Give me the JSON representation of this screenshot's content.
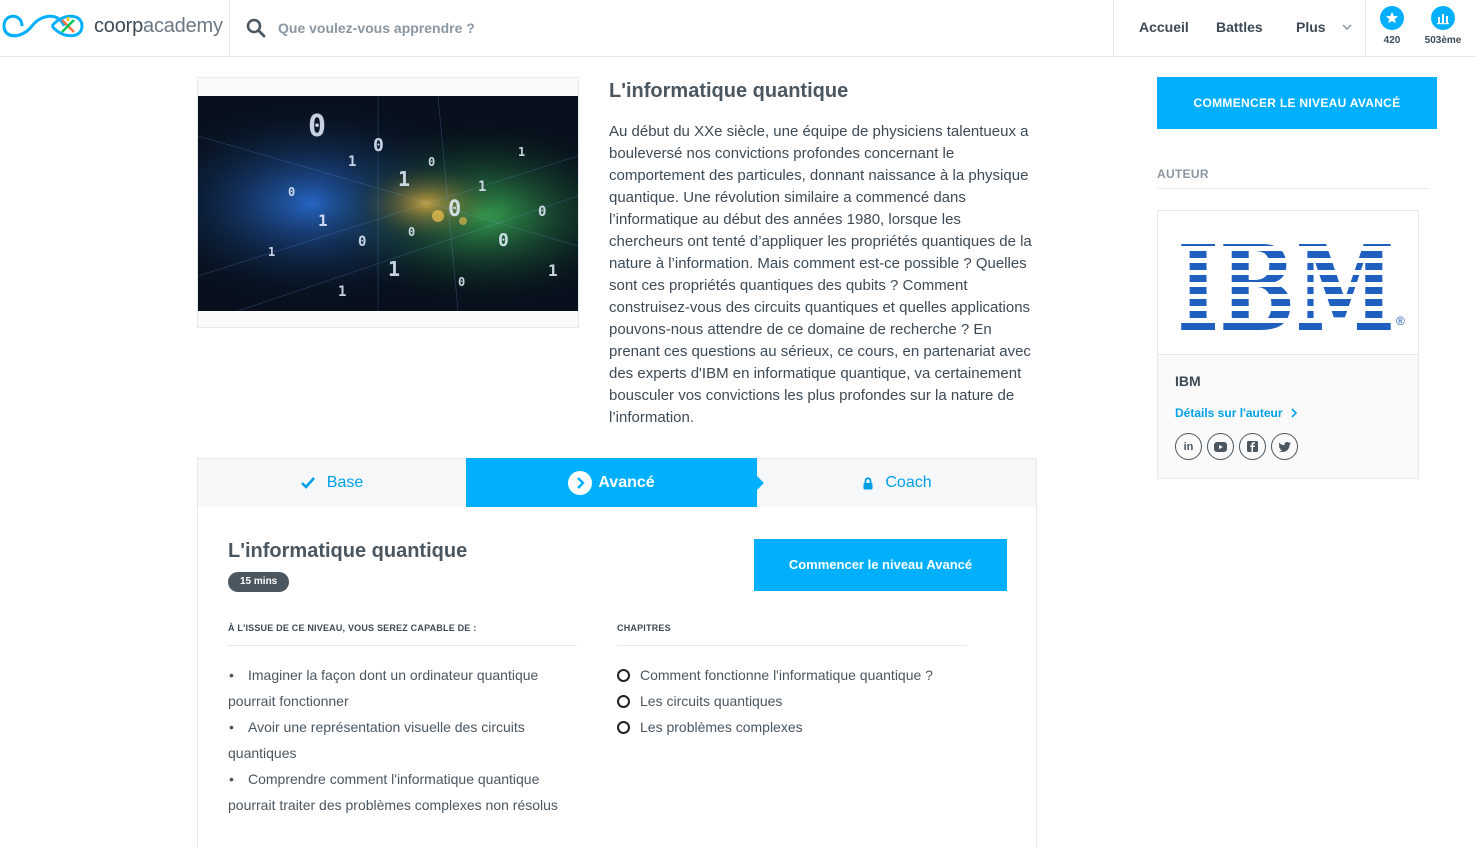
{
  "header": {
    "logo": {
      "brand_bold": "coorp",
      "brand_light": "academy"
    },
    "search": {
      "placeholder": "Que voulez-vous apprendre ?",
      "icon": "search-icon"
    },
    "nav": {
      "home": "Accueil",
      "battles": "Battles",
      "more": "Plus"
    },
    "stats": {
      "stars": "420",
      "rank": "503ème"
    }
  },
  "course": {
    "title": "L'informatique quantique",
    "description": "Au début du XXe siècle, une équipe de physiciens talentueux a bouleversé nos convictions profondes concernant le comportement des particules, donnant naissance à la physique quantique. Une révolution similaire a commencé dans l’informatique au début des années 1980, lorsque les chercheurs ont tenté d’appliquer les propriétés quantiques de la nature à l’information. Mais comment est-ce possible ? Quelles sont ces propriétés quantiques des qubits ? Comment construisez-vous des circuits quantiques et quelles applications pouvons-nous attendre de ce domaine de recherche ? En prenant ces questions au sérieux, ce cours, en partenariat avec des experts d'IBM en informatique quantique, va certainement bousculer vos convictions les plus profondes sur la nature de l’information."
  },
  "sidebar": {
    "cta": "COMMENCER LE NIVEAU AVANCÉ",
    "author_label": "AUTEUR",
    "author": {
      "name": "IBM",
      "logo_text": "IBM",
      "details_link": "Détails sur l'auteur",
      "socials": [
        "linkedin-icon",
        "youtube-icon",
        "facebook-icon",
        "twitter-icon"
      ]
    }
  },
  "tabs": {
    "base": "Base",
    "advanced": "Avancé",
    "coach": "Coach"
  },
  "level": {
    "title": "L'informatique quantique",
    "duration": "15 mins",
    "cta": "Commencer le niveau Avancé",
    "objectives_label": "À L'ISSUE DE CE NIVEAU, VOUS SEREZ CAPABLE DE :",
    "objectives": [
      "Imaginer la façon dont un ordinateur quantique pourrait fonctionner",
      "Avoir une représentation visuelle des circuits quantiques",
      "Comprendre comment l'informatique quantique pourrait traiter des problèmes complexes non résolus"
    ],
    "chapters_label": "CHAPITRES",
    "chapters": [
      "Comment fonctionne l'informatique quantique ?",
      "Les circuits quantiques",
      "Les problèmes complexes"
    ]
  },
  "colors": {
    "accent": "#00b0ff",
    "text": "#3d4a55",
    "muted": "#8a97a2"
  }
}
